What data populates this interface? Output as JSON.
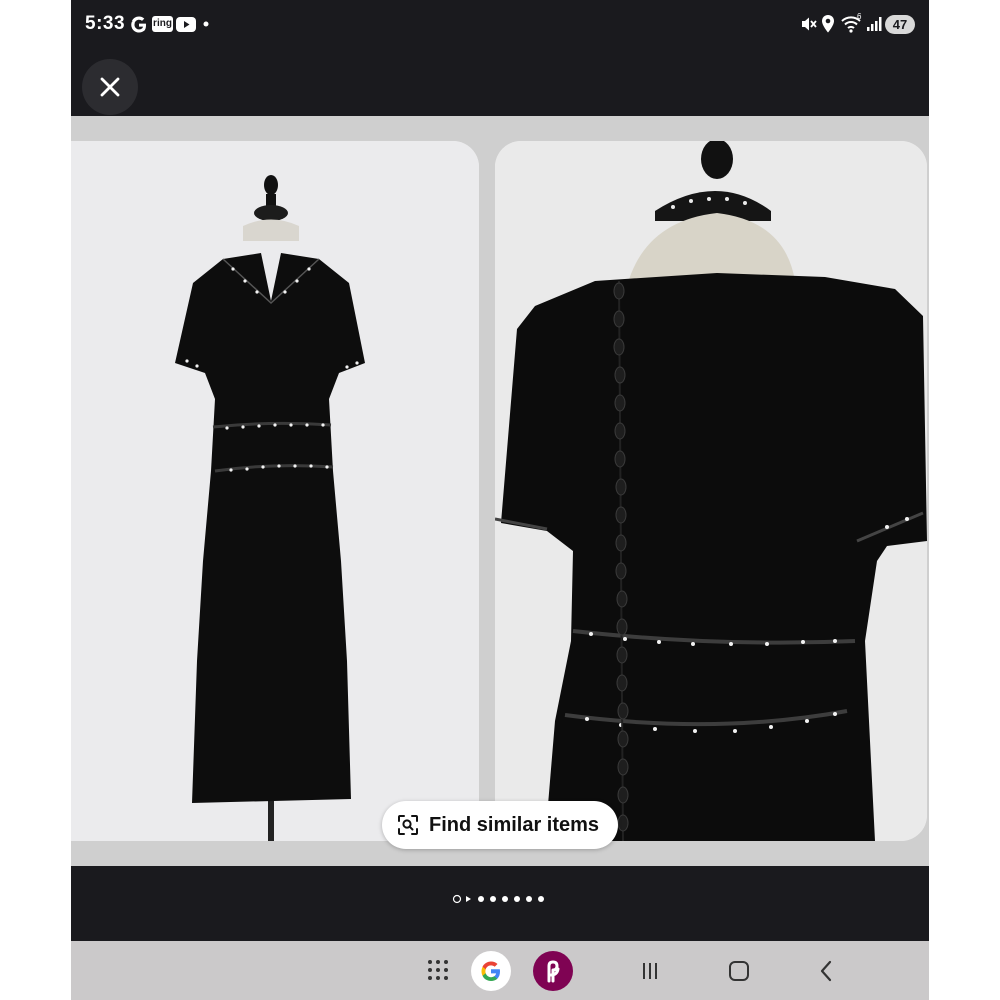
{
  "status_bar": {
    "time": "5:33",
    "left_icons": [
      "google-icon",
      "ring-icon",
      "youtube-icon",
      "dot-icon"
    ],
    "ring_label": "ring",
    "right_icons": [
      "mute-icon",
      "location-icon",
      "wifi-icon",
      "signal-icon"
    ],
    "wifi_label": "6",
    "battery": "47"
  },
  "header": {
    "close_icon": "close-icon"
  },
  "carousel": {
    "images": [
      {
        "subject": "black dress front on mannequin"
      },
      {
        "subject": "black dress back on mannequin"
      }
    ],
    "find_similar_label": "Find similar items",
    "find_similar_icon": "visual-search-icon",
    "page_count": 8,
    "current_page": 1
  },
  "nav_bar": {
    "items": [
      "app-drawer-icon",
      "google-app-icon",
      "poshmark-app-icon",
      "recents-icon",
      "home-icon",
      "back-icon"
    ]
  },
  "colors": {
    "background": "#1a1a1e",
    "content_bg": "#cfcfcf",
    "nav_bg": "#cbc9ca",
    "accent_poshmark": "#7f0353"
  }
}
